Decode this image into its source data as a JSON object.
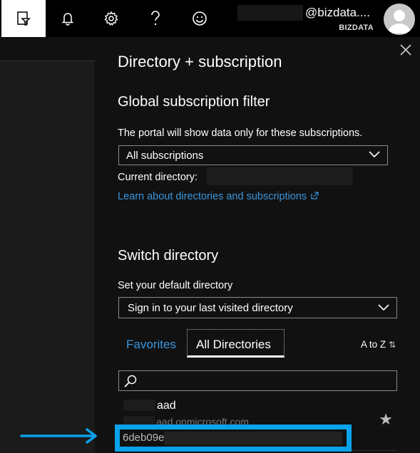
{
  "header": {
    "account_name": "@bizdata....",
    "account_tenant": "BIZDATA",
    "icons": [
      "directory-filter-icon",
      "bell-icon",
      "gear-icon",
      "help-icon",
      "smiley-icon"
    ]
  },
  "blade": {
    "title": "Directory + subscription",
    "global_filter": {
      "heading": "Global subscription filter",
      "description": "The portal will show data only for these subscriptions.",
      "select_value": "All subscriptions",
      "current_directory_label": "Current directory:",
      "learn_link": "Learn about directories and subscriptions"
    },
    "switch_directory": {
      "heading": "Switch directory",
      "default_label": "Set your default directory",
      "default_value": "Sign in to your last visited directory"
    },
    "tabs": {
      "favorites": "Favorites",
      "all": "All Directories",
      "sort": "A to Z"
    },
    "directory": {
      "name": "aad",
      "domain": "aad.onmicrosoft.com",
      "id_prefix": "6deb09e"
    }
  },
  "colors": {
    "accent": "#3a96dd",
    "highlight": "#0aa2ea",
    "background": "#111111"
  }
}
